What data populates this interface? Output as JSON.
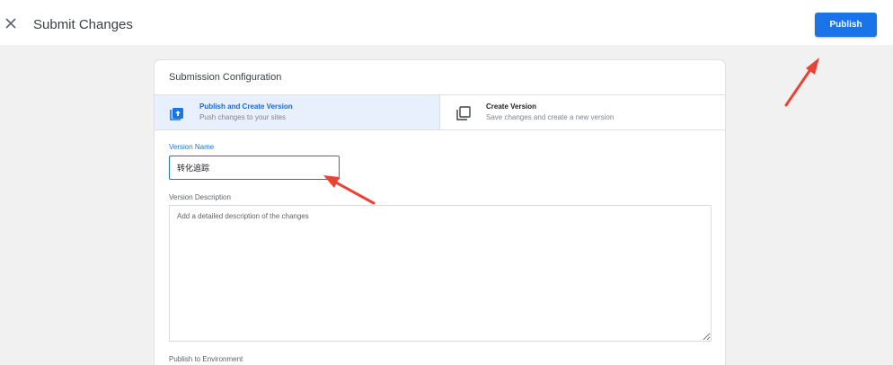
{
  "header": {
    "title": "Submit Changes",
    "publish_label": "Publish",
    "accent": "#1a73e8"
  },
  "card": {
    "heading": "Submission Configuration",
    "options": [
      {
        "title": "Publish and Create Version",
        "subtitle": "Push changes to your sites",
        "icon": "publish-upload-icon",
        "selected": true
      },
      {
        "title": "Create Version",
        "subtitle": "Save changes and create a new version",
        "icon": "copy-version-icon",
        "selected": false
      }
    ],
    "version_name": {
      "label": "Version Name",
      "value": "转化追踪"
    },
    "version_description": {
      "label": "Version Description",
      "placeholder": "Add a detailed description of the changes",
      "value": ""
    },
    "environment_label": "Publish to Environment"
  },
  "annotations": {
    "arrow_color": "#ea4335"
  }
}
